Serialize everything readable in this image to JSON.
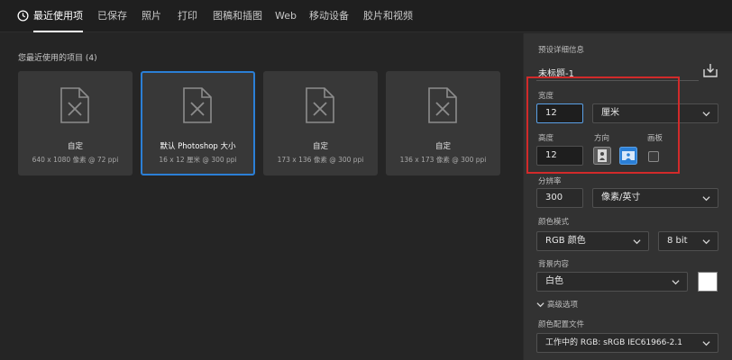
{
  "tabs": [
    {
      "label": "最近使用项",
      "active": true
    },
    {
      "label": "已保存"
    },
    {
      "label": "照片"
    },
    {
      "label": "打印"
    },
    {
      "label": "图稿和插图"
    },
    {
      "label": "Web"
    },
    {
      "label": "移动设备"
    },
    {
      "label": "胶片和视频"
    }
  ],
  "recent": {
    "title": "您最近使用的项目 (4)",
    "items": [
      {
        "name": "自定",
        "details": "640 x 1080 像素 @ 72 ppi",
        "selected": false
      },
      {
        "name": "默认 Photoshop 大小",
        "details": "16 x 12 厘米 @ 300 ppi",
        "selected": true
      },
      {
        "name": "自定",
        "details": "173 x 136 像素 @ 300 ppi",
        "selected": false
      },
      {
        "name": "自定",
        "details": "136 x 173 像素 @ 300 ppi",
        "selected": false
      }
    ]
  },
  "panel": {
    "heading": "预设详细信息",
    "doc_name": "未标题-1",
    "width_label": "宽度",
    "width_value": "12",
    "unit_value": "厘米",
    "height_label": "高度",
    "height_value": "12",
    "orientation_label": "方向",
    "artboard_label": "画板",
    "resolution_label": "分辨率",
    "resolution_value": "300",
    "resolution_unit": "像素/英寸",
    "color_mode_label": "颜色模式",
    "color_mode_value": "RGB 颜色",
    "bit_depth_value": "8 bit",
    "background_label": "背景内容",
    "background_value": "白色",
    "advanced_label": "高级选项",
    "color_profile_label": "颜色配置文件",
    "color_profile_value": "工作中的 RGB: sRGB IEC61966-2.1"
  },
  "colors": {
    "accent": "#2b7fd6",
    "highlight": "#d22a2a",
    "swatch": "#ffffff"
  }
}
